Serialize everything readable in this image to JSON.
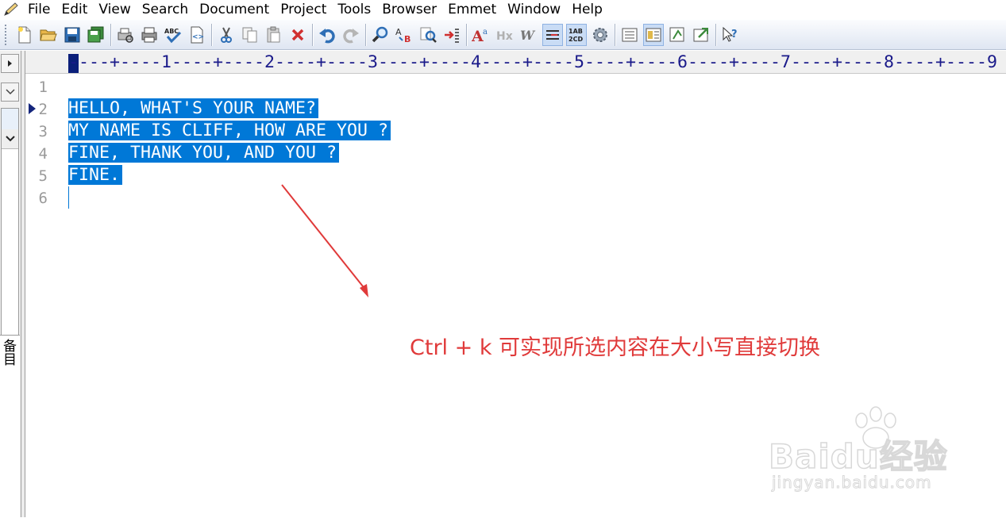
{
  "menu": {
    "items": [
      "File",
      "Edit",
      "View",
      "Search",
      "Document",
      "Project",
      "Tools",
      "Browser",
      "Emmet",
      "Window",
      "Help"
    ]
  },
  "toolbar": {
    "icons": [
      "new-file-icon",
      "open-folder-icon",
      "save-icon",
      "save-all-icon",
      "print-preview-icon",
      "print-icon",
      "spellcheck-icon",
      "html-preview-icon",
      "cut-icon",
      "copy-icon",
      "paste-icon",
      "delete-icon",
      "undo-icon",
      "redo-icon",
      "find-icon",
      "replace-icon",
      "find-in-files-icon",
      "indent-icon",
      "font-size-icon",
      "heading-icon",
      "word-wrap-icon",
      "show-spaces-icon",
      "line-numbers-icon",
      "settings-gear-icon",
      "window-list-icon",
      "clip-library-icon",
      "output-window-icon",
      "browser-view-icon",
      "help-pointer-icon"
    ]
  },
  "left_panel": {
    "tab_label": "备目"
  },
  "ruler": {
    "text": "----+----1----+----2----+----3----+----4----+----5----+----6----+----7----+----8----+----9"
  },
  "editor": {
    "line_numbers": [
      "1",
      "2",
      "3",
      "4",
      "5",
      "6"
    ],
    "lines": [
      "",
      "HELLO, WHAT'S YOUR NAME?",
      "MY NAME IS CLIFF, HOW ARE YOU ?",
      "FINE, THANK YOU, AND YOU ?",
      "FINE.",
      ""
    ],
    "selection_color": "#0078d7"
  },
  "annotation": {
    "text": "Ctrl + k 可实现所选内容在大小写直接切换",
    "color": "#e03a3a"
  },
  "watermark": {
    "brand": "Baidu经验",
    "url": "jingyan.baidu.com"
  }
}
